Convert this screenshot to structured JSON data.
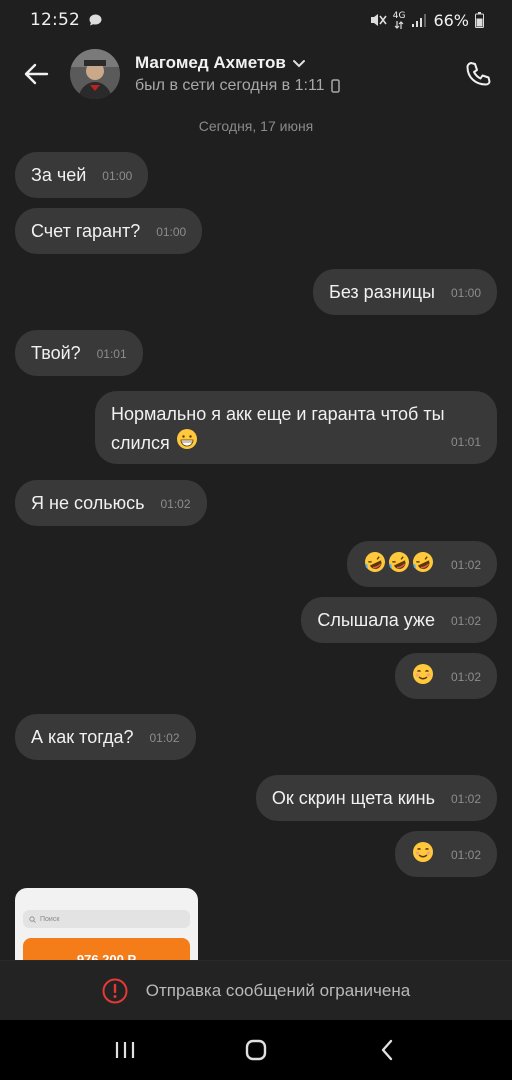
{
  "status_bar": {
    "time": "12:52",
    "network": "4G",
    "battery": "66%"
  },
  "header": {
    "contact_name": "Магомед Ахметов",
    "last_seen": "был в сети сегодня в 1:11"
  },
  "chat": {
    "date_separator": "Сегодня, 17 июня",
    "messages": [
      {
        "direction": "in",
        "text": "За чей",
        "time": "01:00"
      },
      {
        "direction": "in",
        "text": "Счет гарант?",
        "time": "01:00"
      },
      {
        "direction": "out",
        "text": "Без разницы",
        "time": "01:00"
      },
      {
        "direction": "in",
        "text": "Твой?",
        "time": "01:01"
      },
      {
        "direction": "out",
        "text_line1": "Нормально я акк еще и гаранта чтоб ты",
        "text_line2": "слился",
        "emoji": "grinning-face",
        "time": "01:01"
      },
      {
        "direction": "in",
        "text": "Я не сольюсь",
        "time": "01:02"
      },
      {
        "direction": "out",
        "emoji": "rofl x3",
        "time": "01:02"
      },
      {
        "direction": "out",
        "text": "Слышала уже",
        "time": "01:02"
      },
      {
        "direction": "out",
        "emoji": "smiling-face",
        "time": "01:02"
      },
      {
        "direction": "in",
        "text": "А как тогда?",
        "time": "01:02"
      },
      {
        "direction": "out",
        "text": "Ок скрин щета кинь",
        "time": "01:02"
      },
      {
        "direction": "out",
        "emoji": "smiling-face",
        "time": "01:02"
      }
    ],
    "screenshot_attachment": {
      "search_placeholder": "Поиск",
      "amount_partial": "976 200 Р"
    }
  },
  "restriction": {
    "text": "Отправка сообщений ограничена"
  },
  "colors": {
    "background": "#1f1f1f",
    "bubble": "#393939",
    "warning": "#e53935",
    "attachment_orange": "#f47d1a"
  }
}
